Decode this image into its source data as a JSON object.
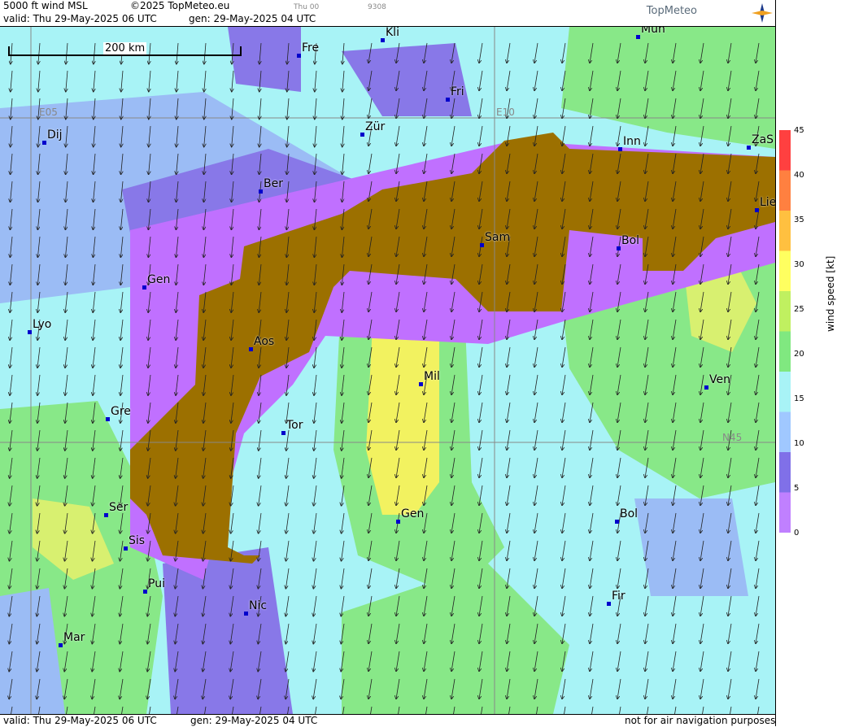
{
  "header": {
    "title": "5000 ft wind MSL",
    "copyright": "©2025 TopMeteo.eu",
    "valid": "valid:  Thu  29-May-2025  06 UTC",
    "gen": "gen: 29-May-2025 04 UTC",
    "small1": "Thu 00",
    "small2": "9308",
    "logo": "TopMeteo"
  },
  "scale": {
    "label": "200 km"
  },
  "grid_labels": [
    "E05",
    "E10",
    "N45"
  ],
  "cities": [
    {
      "name": "Fre"
    },
    {
      "name": "Kli"
    },
    {
      "name": "Mün"
    },
    {
      "name": "Fri"
    },
    {
      "name": "Dij"
    },
    {
      "name": "Zür"
    },
    {
      "name": "Inn"
    },
    {
      "name": "ZaS"
    },
    {
      "name": "Ber"
    },
    {
      "name": "Lie"
    },
    {
      "name": "Sam"
    },
    {
      "name": "Bol"
    },
    {
      "name": "Gen"
    },
    {
      "name": "Lyo"
    },
    {
      "name": "Aos"
    },
    {
      "name": "Mil"
    },
    {
      "name": "Ven"
    },
    {
      "name": "Gre"
    },
    {
      "name": "Tor"
    },
    {
      "name": "Ser"
    },
    {
      "name": "Gen"
    },
    {
      "name": "Bol"
    },
    {
      "name": "Sis"
    },
    {
      "name": "Pui"
    },
    {
      "name": "Nic"
    },
    {
      "name": "Fir"
    },
    {
      "name": "Mar"
    }
  ],
  "legend": {
    "title": "wind speed [kt]",
    "ticks": [
      "45",
      "40",
      "35",
      "30",
      "25",
      "20",
      "15",
      "10",
      "5",
      "0"
    ],
    "colors": [
      "#c080ff",
      "#8070e8",
      "#a0c8ff",
      "#a8f3f6",
      "#80e880",
      "#c0f060",
      "#ffff60",
      "#ffc040",
      "#ff8040",
      "#ff4040"
    ]
  },
  "footer": {
    "valid": "valid:  Thu  29-May-2025  06 UTC",
    "gen": "gen: 29-May-2025 04 UTC",
    "note": "not for air navigation purposes"
  }
}
